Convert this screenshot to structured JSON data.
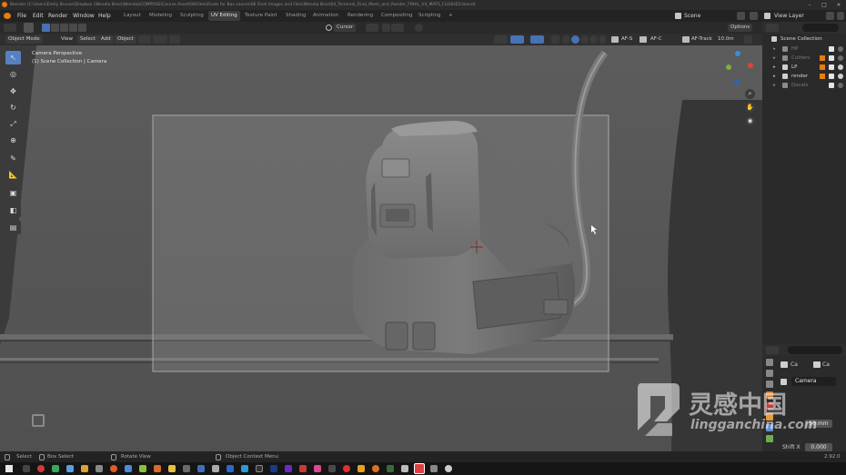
{
  "titlebar": {
    "title": "Blender [C:\\Users\\Emily Brusso\\Dropbox (Wendia Bros)\\Wendia\\COMPOSE\\Course Asset\\06\\Files\\Finals for Bas course\\06 Final Images and Files\\Wendia Bros\\04_Terminal_Final_Mesh_and_Render_FINAL_V4_MATS_FLUSHED.blend]"
  },
  "menubar": {
    "menus": [
      "File",
      "Edit",
      "Render",
      "Window",
      "Help"
    ],
    "workspaces": [
      "Layout",
      "Modeling",
      "Sculpting",
      "UV Editing",
      "Texture Paint",
      "Shading",
      "Animation",
      "Rendering",
      "Compositing",
      "Scripting"
    ],
    "add_workspace": "+",
    "scene_label": "Scene",
    "view_layer_label": "View Layer"
  },
  "tool_header": {
    "orientation": "Cursor",
    "options": "Options"
  },
  "viewport_header": {
    "mode": "Object Mode",
    "menus": [
      "View",
      "Select",
      "Add",
      "Object"
    ],
    "af_s": "AF-S",
    "af_c": "AF-C",
    "af_track": "AF-Track",
    "focal": "10.0m"
  },
  "viewport": {
    "camera_perspective": "Camera Perspective",
    "collection_info": "(1) Scene Collection | Camera"
  },
  "outliner": {
    "title": "Scene Collection",
    "items": [
      {
        "name": "HP",
        "dim": true
      },
      {
        "name": "Cutters",
        "dim": true
      },
      {
        "name": "LP",
        "dim": false
      },
      {
        "name": "render",
        "dim": false
      },
      {
        "name": "Decals",
        "dim": true
      }
    ]
  },
  "properties": {
    "tab_a": "Ca",
    "tab_b": "Ca",
    "object_name": "Camera",
    "focal_value": "50 mm",
    "shift_label": "Shift X",
    "shift_value": "0.000"
  },
  "statusbar": {
    "select": "Select",
    "box_select": "Box Select",
    "rotate_view": "Rotate View",
    "context_menu": "Object Context Menu",
    "version": "2.92.0"
  },
  "watermark": {
    "cn_text": "灵感中国",
    "url_text": "lingganchina.com"
  },
  "colors": {
    "accent": "#4772b3",
    "viewport_bg": "#585858",
    "camera_frame": "#8f8f8f",
    "gizmo_x": "#e0413e",
    "gizmo_y": "#7bb33a",
    "gizmo_z": "#3c8ce0"
  }
}
